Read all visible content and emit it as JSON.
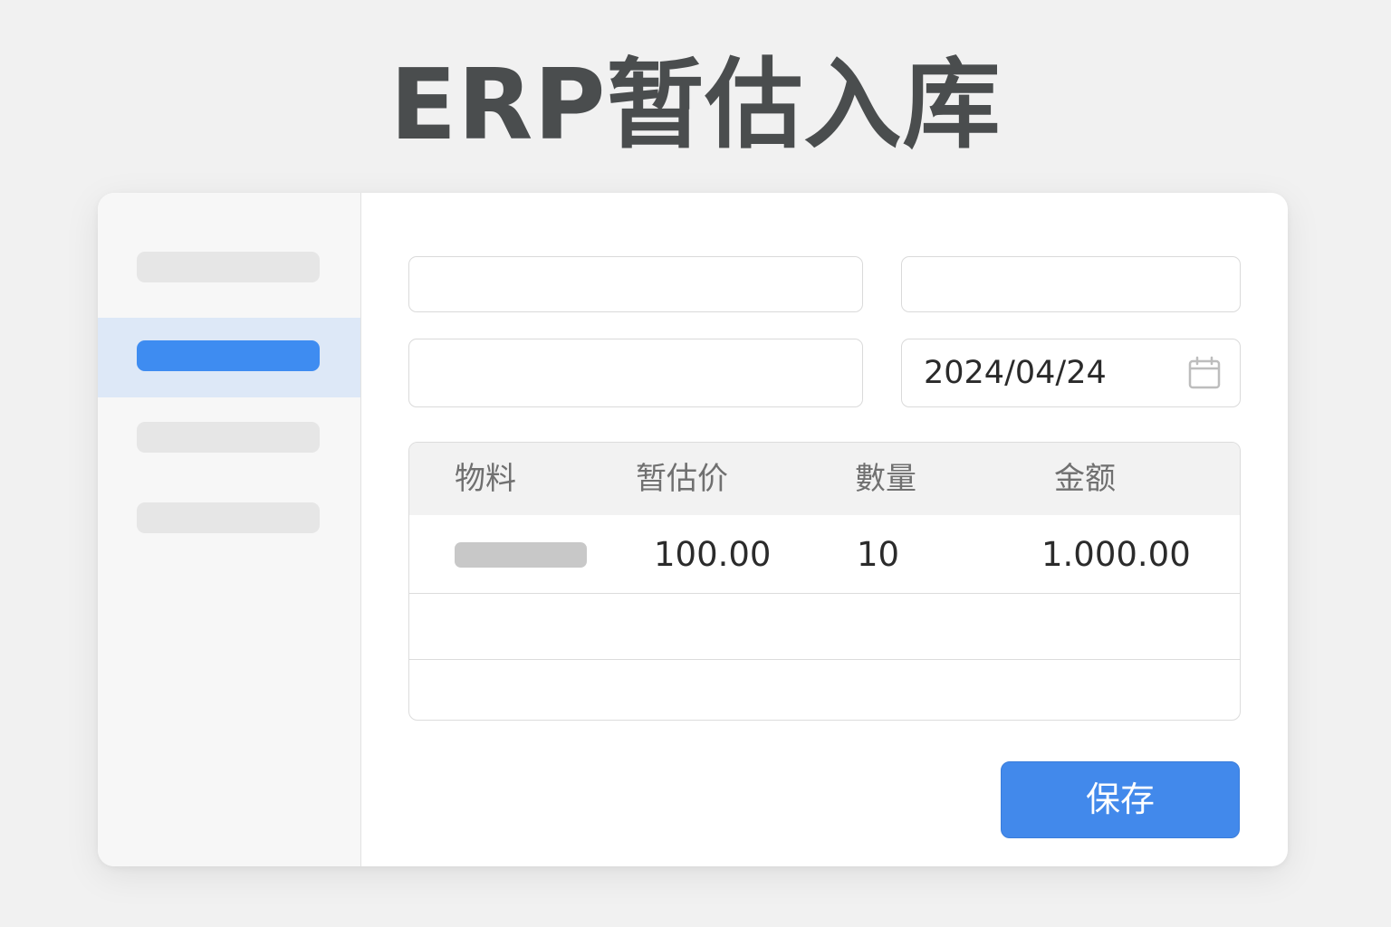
{
  "page": {
    "title": "ERP暂估入库"
  },
  "sidebar": {
    "items": [
      {
        "label": "",
        "active": false
      },
      {
        "label": "",
        "active": true
      },
      {
        "label": "",
        "active": false
      },
      {
        "label": "",
        "active": false
      }
    ]
  },
  "form": {
    "field_top_left": {
      "value": ""
    },
    "field_top_right": {
      "value": ""
    },
    "field_bottom_left": {
      "value": ""
    },
    "date_field": {
      "value": "2024/04/24",
      "icon": "calendar-icon"
    }
  },
  "table": {
    "columns": [
      "物料",
      "暂估价",
      "數量",
      "金额"
    ],
    "rows": [
      {
        "material": "",
        "estimated_price": "100.00",
        "quantity": "10",
        "amount": "1.000.00"
      },
      {
        "material": "",
        "estimated_price": "",
        "quantity": "",
        "amount": ""
      },
      {
        "material": "",
        "estimated_price": "",
        "quantity": "",
        "amount": ""
      }
    ]
  },
  "actions": {
    "save_label": "保存"
  },
  "colors": {
    "accent": "#3e8cf1",
    "button": "#4289eb",
    "active_row": "#dde8f7",
    "title": "#4a4d4e"
  }
}
